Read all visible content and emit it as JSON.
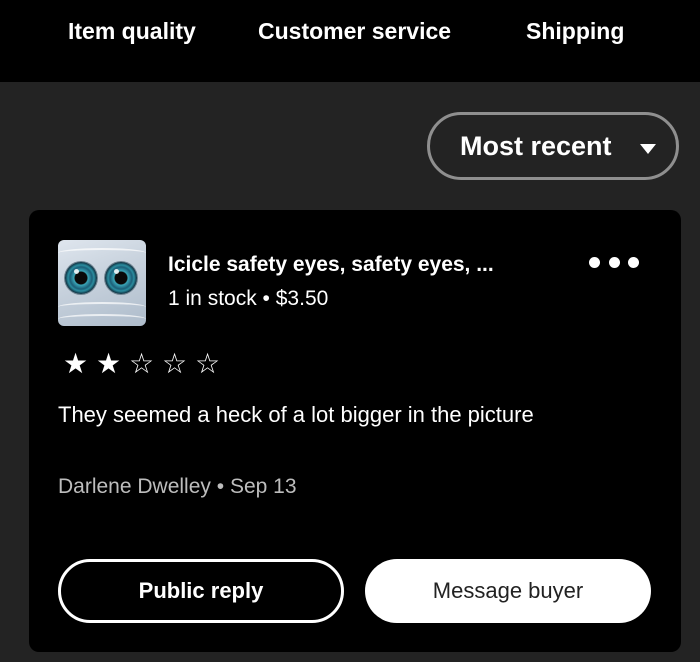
{
  "tabs": [
    {
      "label": "Item quality"
    },
    {
      "label": "Customer service"
    },
    {
      "label": "Shipping"
    }
  ],
  "sort": {
    "label": "Most recent"
  },
  "review": {
    "product_title": "Icicle safety eyes, safety eyes, ...",
    "stock": "1 in stock",
    "separator": " • ",
    "price": "$3.50",
    "rating": 2,
    "rating_max": 5,
    "stars": [
      "★",
      "★",
      "☆",
      "☆",
      "☆"
    ],
    "text": "They seemed a heck of a lot bigger in the picture",
    "reviewer": "Darlene Dwelley",
    "date": "Sep 13"
  },
  "actions": {
    "public_reply": "Public reply",
    "message_buyer": "Message buyer"
  },
  "icons": {
    "more": "more-horizontal-icon",
    "caret": "caret-down-icon",
    "star_filled": "star-filled-icon",
    "star_empty": "star-outline-icon"
  },
  "colors": {
    "background": "#232323",
    "card": "#000000",
    "text_primary": "#ffffff",
    "text_secondary": "#bdbdbd",
    "button_primary_bg": "#ffffff"
  }
}
